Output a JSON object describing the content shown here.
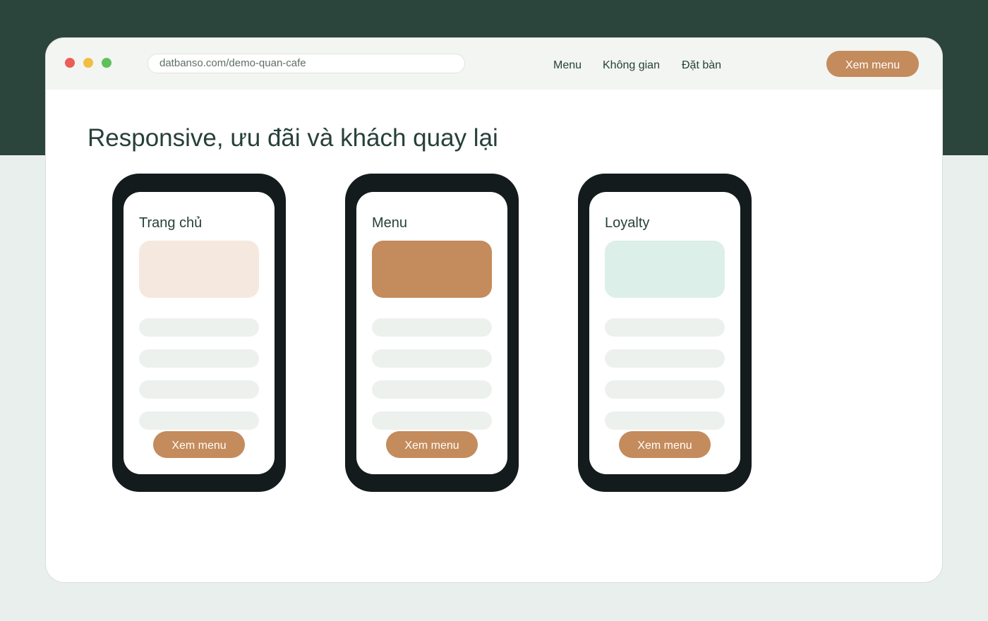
{
  "browser": {
    "url": "datbanso.com/demo-quan-cafe"
  },
  "nav": {
    "items": [
      {
        "label": "Menu"
      },
      {
        "label": "Không gian"
      },
      {
        "label": "Đặt bàn"
      }
    ],
    "cta_label": "Xem menu"
  },
  "colors": {
    "background_dark": "#2b443c",
    "background_light": "#e9efec",
    "accent": "#c48b5c",
    "text": "#27403a",
    "phone_frame": "#131b1d"
  },
  "main": {
    "headline": "Responsive, ưu đãi và khách quay lại",
    "phones": [
      {
        "title": "Trang chủ",
        "hero_color": "#f5e8de",
        "button_label": "Xem menu"
      },
      {
        "title": "Menu",
        "hero_color": "#c48b5c",
        "button_label": "Xem menu"
      },
      {
        "title": "Loyalty",
        "hero_color": "#dcefe9",
        "button_label": "Xem menu"
      }
    ]
  }
}
